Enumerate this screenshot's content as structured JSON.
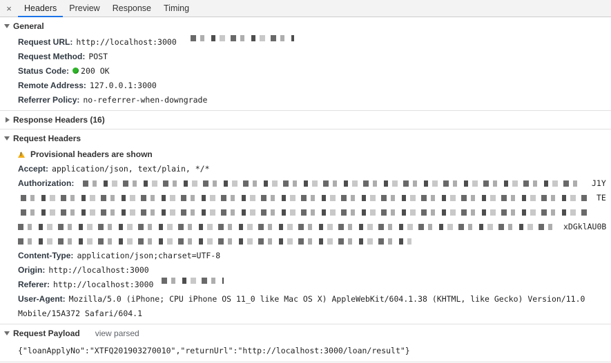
{
  "tabs": {
    "close": "×",
    "items": [
      "Headers",
      "Preview",
      "Response",
      "Timing"
    ],
    "active": "Headers"
  },
  "general": {
    "title": "General",
    "request_url_key": "Request URL:",
    "request_url_val": "http://localhost:3000",
    "request_method_key": "Request Method:",
    "request_method_val": "POST",
    "status_code_key": "Status Code:",
    "status_code_val": "200 OK",
    "status_color": "#2fb32a",
    "remote_address_key": "Remote Address:",
    "remote_address_val": "127.0.0.1:3000",
    "referrer_policy_key": "Referrer Policy:",
    "referrer_policy_val": "no-referrer-when-downgrade"
  },
  "response_headers": {
    "title": "Response Headers (16)"
  },
  "request_headers": {
    "title": "Request Headers",
    "warning": "Provisional headers are shown",
    "accept_key": "Accept:",
    "accept_val": "application/json, text/plain, */*",
    "authorization_key": "Authorization:",
    "auth_tail_1": "J1Y",
    "auth_tail_2": "TE",
    "auth_tail_4": "xDGklAU0B",
    "content_type_key": "Content-Type:",
    "content_type_val": "application/json;charset=UTF-8",
    "origin_key": "Origin:",
    "origin_val": "http://localhost:3000",
    "referer_key": "Referer:",
    "referer_val": "http://localhost:3000",
    "user_agent_key": "User-Agent:",
    "user_agent_val_1": "Mozilla/5.0 (iPhone; CPU iPhone OS 11_0 like Mac OS X) AppleWebKit/604.1.38 (KHTML, like Gecko) Version/11.0",
    "user_agent_val_2": "Mobile/15A372 Safari/604.1"
  },
  "request_payload": {
    "title": "Request Payload",
    "view_parsed": "view parsed",
    "body": "{\"loanApplyNo\":\"XTFQ201903270010\",\"returnUrl\":\"http://localhost:3000/loan/result\"}"
  },
  "icons": {
    "status": "status-dot-icon",
    "warning": "warning-icon",
    "expanded": "triangle-down-icon",
    "collapsed": "triangle-right-icon"
  }
}
